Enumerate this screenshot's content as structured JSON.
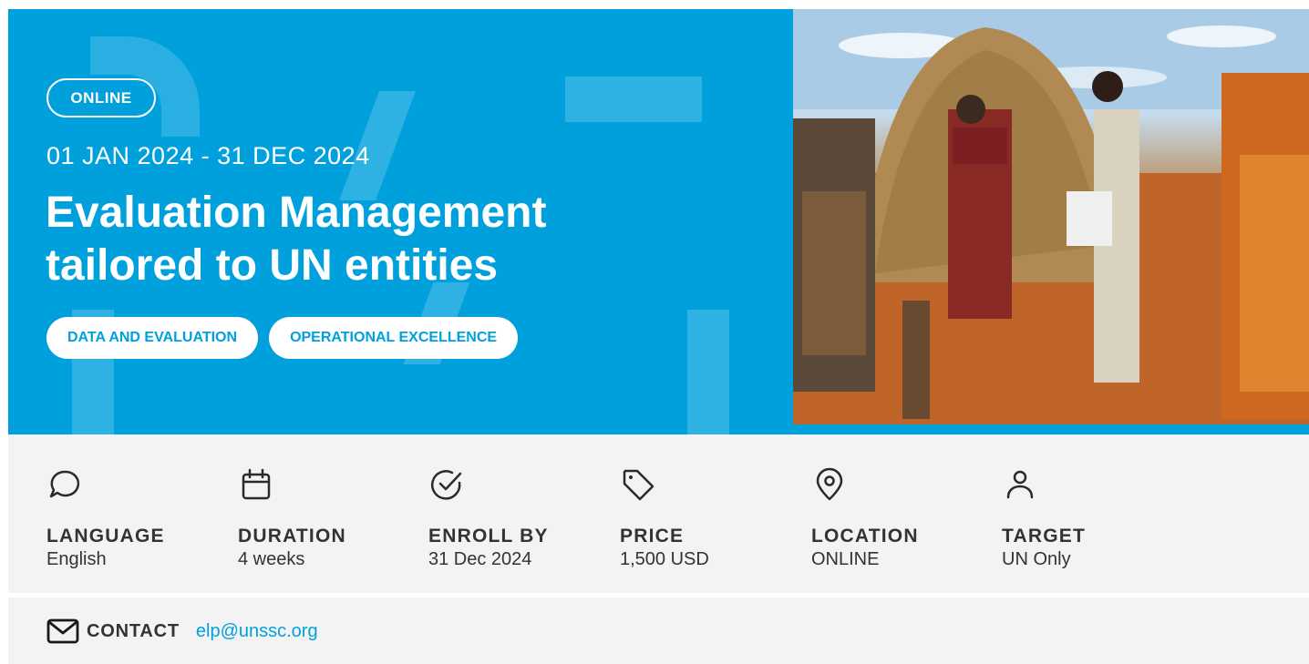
{
  "hero": {
    "badge": "ONLINE",
    "dates": "01 JAN 2024 - 31 DEC 2024",
    "title_line1": "Evaluation Management",
    "title_line2": "tailored to UN entities",
    "tags": [
      "DATA AND EVALUATION",
      "OPERATIONAL EXCELLENCE"
    ],
    "accent_color": "#00a0dd"
  },
  "info": [
    {
      "icon": "speech-bubble-icon",
      "label": "LANGUAGE",
      "value": "English"
    },
    {
      "icon": "calendar-icon",
      "label": "DURATION",
      "value": "4 weeks"
    },
    {
      "icon": "check-circle-icon",
      "label": "ENROLL BY",
      "value": "31 Dec 2024"
    },
    {
      "icon": "price-tag-icon",
      "label": "PRICE",
      "value": "1,500 USD"
    },
    {
      "icon": "location-pin-icon",
      "label": "LOCATION",
      "value": "ONLINE"
    },
    {
      "icon": "person-icon",
      "label": "TARGET",
      "value": "UN Only"
    }
  ],
  "contact": {
    "icon": "envelope-icon",
    "label": "CONTACT",
    "email": "elp@unssc.org"
  }
}
